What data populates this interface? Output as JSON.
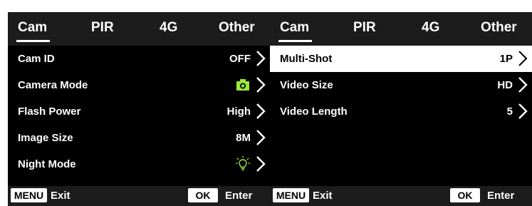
{
  "colors": {
    "background": "#000000",
    "bar": "#1c1c1c",
    "accent_icon": "#9be83a",
    "selected_row": "#ffffff"
  },
  "left": {
    "tabs": [
      {
        "label": "Cam",
        "active": true
      },
      {
        "label": "PIR",
        "active": false
      },
      {
        "label": "4G",
        "active": false
      },
      {
        "label": "Other",
        "active": false
      }
    ],
    "rows": [
      {
        "label": "Cam ID",
        "value": "OFF"
      },
      {
        "label": "Camera Mode",
        "value_icon": "camera-icon"
      },
      {
        "label": "Flash Power",
        "value": "High"
      },
      {
        "label": "Image Size",
        "value": "8M"
      },
      {
        "label": "Night Mode",
        "value_icon": "lightbulb-icon"
      }
    ],
    "footer": {
      "menu_key": "MENU",
      "menu_action": "Exit",
      "ok_key": "OK",
      "ok_action": "Enter"
    }
  },
  "right": {
    "tabs": [
      {
        "label": "Cam",
        "active": true
      },
      {
        "label": "PIR",
        "active": false
      },
      {
        "label": "4G",
        "active": false
      },
      {
        "label": "Other",
        "active": false
      }
    ],
    "rows": [
      {
        "label": "Multi-Shot",
        "value": "1P",
        "selected": true
      },
      {
        "label": "Video Size",
        "value": "HD"
      },
      {
        "label": "Video Length",
        "value": "5"
      }
    ],
    "footer": {
      "menu_key": "MENU",
      "menu_action": "Exit",
      "ok_key": "OK",
      "ok_action": "Enter"
    }
  }
}
